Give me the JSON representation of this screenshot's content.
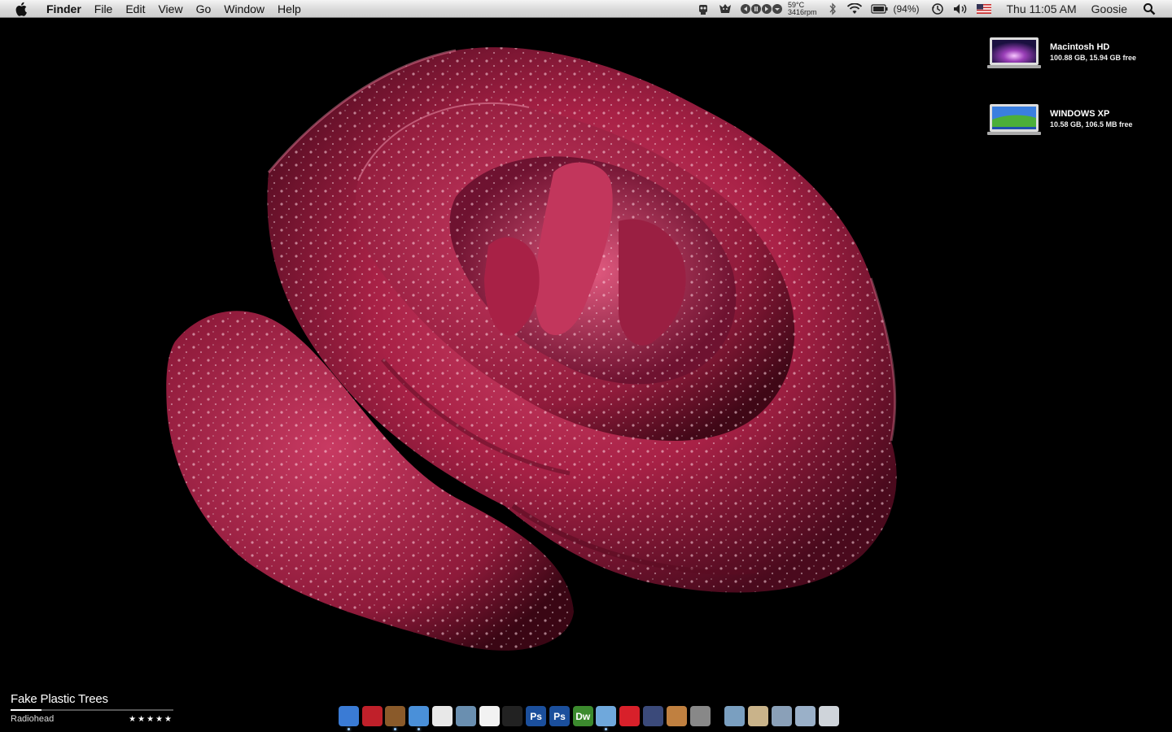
{
  "menubar": {
    "app_name": "Finder",
    "menus": [
      "File",
      "Edit",
      "View",
      "Go",
      "Window",
      "Help"
    ],
    "temperature": "59°C",
    "fan_speed": "3416rpm",
    "battery": "(94%)",
    "clock": "Thu 11:05 AM",
    "user": "Goosie"
  },
  "desktop": {
    "drives": [
      {
        "name": "Macintosh HD",
        "info": "100.88 GB, 15.94 GB free"
      },
      {
        "name": "WINDOWS XP",
        "info": "10.58 GB, 106.5 MB free"
      }
    ]
  },
  "now_playing": {
    "title": "Fake Plastic Trees",
    "artist": "Radiohead",
    "rating_stars": "★★★★★",
    "progress_fraction": 0.19
  },
  "dock": {
    "apps": [
      {
        "name": "finder-icon",
        "glyph": "",
        "color": "#3a7bd5",
        "running": true
      },
      {
        "name": "photo-booth-icon",
        "glyph": "",
        "color": "#c0202a",
        "running": false
      },
      {
        "name": "mail-stamp-icon",
        "glyph": "",
        "color": "#8a5a2a",
        "running": true
      },
      {
        "name": "safari-icon",
        "glyph": "",
        "color": "#4a90d9",
        "running": true
      },
      {
        "name": "address-book-icon",
        "glyph": "",
        "color": "#e8e8e8",
        "running": false
      },
      {
        "name": "iphoto-icon",
        "glyph": "",
        "color": "#6a8fb0",
        "running": false
      },
      {
        "name": "flickr-uploadr-icon",
        "glyph": "",
        "color": "#f2f2f2",
        "running": false
      },
      {
        "name": "dvd-player-icon",
        "glyph": "",
        "color": "#222",
        "running": false
      },
      {
        "name": "photoshop-icon",
        "glyph": "Ps",
        "color": "#1b4f9c",
        "running": false
      },
      {
        "name": "photoshop-alt-icon",
        "glyph": "Ps",
        "color": "#1b4f9c",
        "running": false
      },
      {
        "name": "dreamweaver-icon",
        "glyph": "Dw",
        "color": "#3c8a2e",
        "running": false
      },
      {
        "name": "itunes-icon",
        "glyph": "",
        "color": "#6fa8dc",
        "running": true
      },
      {
        "name": "creative-suite-icon",
        "glyph": "",
        "color": "#d8202a",
        "running": false
      },
      {
        "name": "pen-tool-icon",
        "glyph": "",
        "color": "#3b4a7a",
        "running": false
      },
      {
        "name": "preview-icon",
        "glyph": "",
        "color": "#c08040",
        "running": false
      },
      {
        "name": "system-preferences-icon",
        "glyph": "",
        "color": "#888",
        "running": false
      }
    ],
    "folders": [
      {
        "name": "applications-folder-icon",
        "color": "#7a9fc0"
      },
      {
        "name": "documents-folder-icon",
        "color": "#c9b38a"
      },
      {
        "name": "downloads-folder-icon",
        "color": "#8aa0b8"
      },
      {
        "name": "printer-icon",
        "color": "#9ab0c8"
      },
      {
        "name": "trash-icon",
        "color": "#cfd4da"
      }
    ]
  }
}
